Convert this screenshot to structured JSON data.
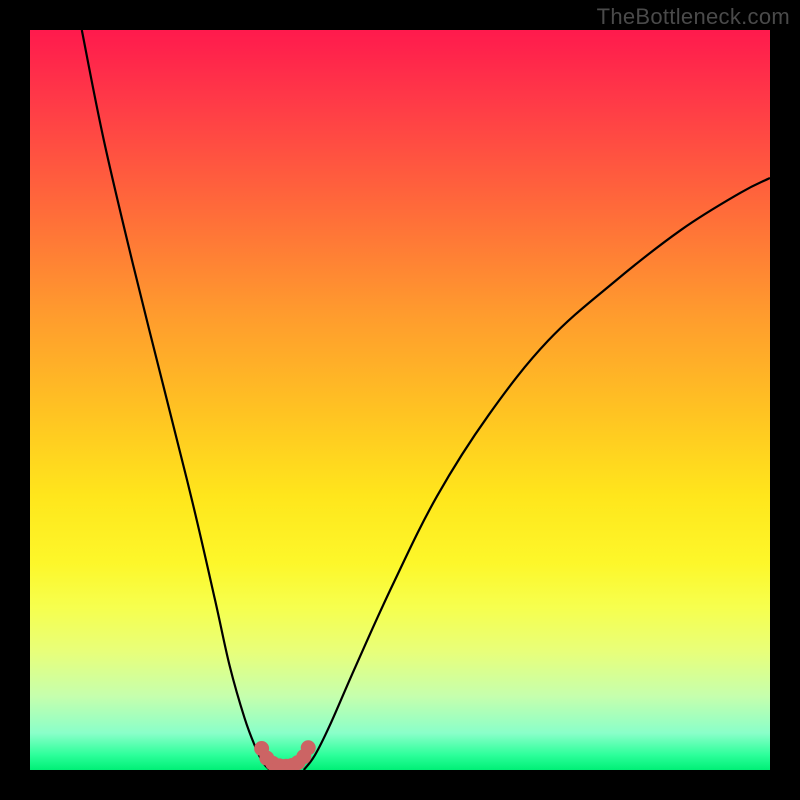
{
  "watermark": {
    "text": "TheBottleneck.com"
  },
  "chart_data": {
    "type": "line",
    "title": "",
    "xlabel": "",
    "ylabel": "",
    "xlim": [
      0,
      100
    ],
    "ylim": [
      0,
      100
    ],
    "grid": false,
    "legend": false,
    "background": "rainbow-gradient-red-to-green",
    "series": [
      {
        "name": "left-branch",
        "x": [
          7,
          10,
          14,
          18,
          22,
          25,
          27,
          29,
          30.5,
          31.5,
          32.4
        ],
        "y": [
          100,
          85,
          68,
          52,
          36,
          23,
          14,
          7,
          3,
          1,
          0
        ]
      },
      {
        "name": "right-branch",
        "x": [
          37,
          38.5,
          40.5,
          44,
          49,
          55,
          62,
          70,
          79,
          88,
          96,
          100
        ],
        "y": [
          0,
          2,
          6,
          14,
          25,
          37,
          48,
          58,
          66,
          73,
          78,
          80
        ]
      }
    ],
    "annotations": {
      "valley_markers": {
        "comment": "small reddish dots near the valley floor forming a U shape",
        "x": [
          31.3,
          32.0,
          32.8,
          33.7,
          34.6,
          35.4,
          36.2,
          37.0,
          37.6
        ],
        "y": [
          2.9,
          1.6,
          0.9,
          0.55,
          0.5,
          0.6,
          1.0,
          1.8,
          3.0
        ],
        "color": "#cc6464"
      }
    }
  }
}
